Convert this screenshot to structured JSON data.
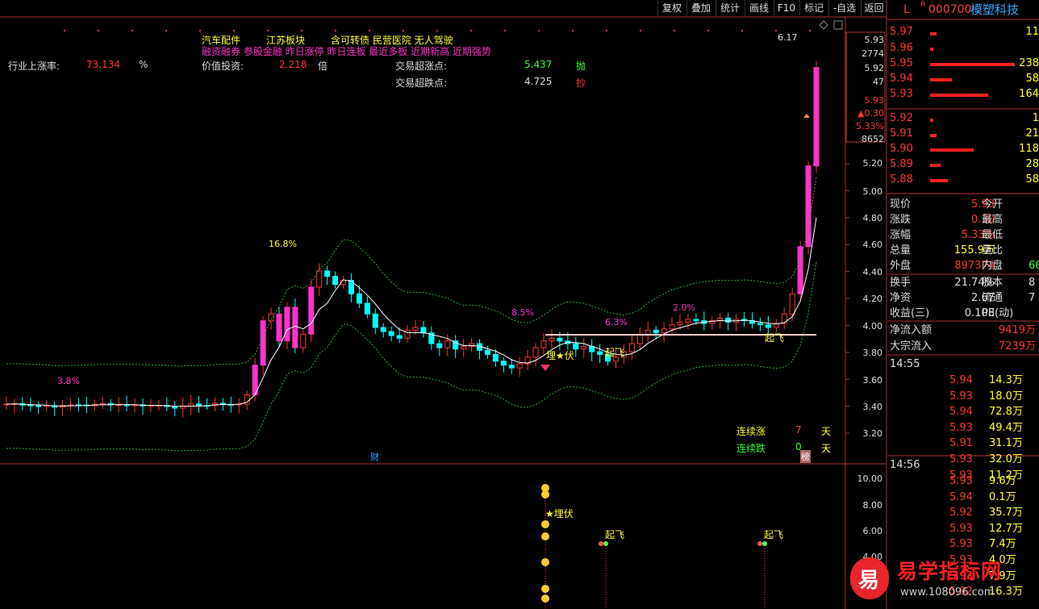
{
  "toolbar": {
    "buttons": [
      "复权",
      "叠加",
      "统计",
      "画线",
      "F10",
      "标记",
      "-自选",
      "返回"
    ]
  },
  "header": {
    "flag_l": "L",
    "flag_r": "R",
    "code": "000700",
    "name": "模塑科技"
  },
  "info": {
    "concepts_line1": [
      "汽车配件",
      "江苏板块",
      "含可转债 民营医院 无人驾驶"
    ],
    "concepts_line2": "融资融券 参股金融 昨日涨停 昨日连板 最近多板 近期新高 近期强势",
    "industry_label": "行业上涨率:",
    "industry_value": "73.134",
    "industry_unit": "%",
    "value_label": "价值投资:",
    "value_value": "2.218",
    "value_unit": "倍",
    "sell_label": "交易超涨点:",
    "sell_value": "5.437",
    "sell_tag": "抛",
    "buy_label": "交易超跌点:",
    "buy_value": "4.725",
    "buy_tag": "抄",
    "up_days_label": "连续涨",
    "up_days_value": "7",
    "up_days_unit": "天",
    "down_days_label": "连续跌",
    "down_days_value": "0",
    "down_days_unit": "天",
    "cai_tag": "财",
    "bang_tag": "榜"
  },
  "main_axis": {
    "ticks": [
      "5.93",
      "2774",
      "5.92",
      "47",
      "5.93",
      "▲0.30",
      "5.33%",
      "8652",
      "5.20",
      "5.00",
      "4.80",
      "4.60",
      "4.40",
      "4.20",
      "4.00",
      "3.80",
      "3.60",
      "3.40",
      "3.20"
    ]
  },
  "sub_axis": {
    "ticks": [
      "10.00",
      "8.00",
      "6.00",
      "4.00"
    ]
  },
  "chart_labels": {
    "peak_label": "6.17",
    "pct_labels": [
      "3.8%",
      "16.8%",
      "8.5%",
      "6.3%",
      "2.0%"
    ],
    "signal_maifu": "埋★伏",
    "signal_qifei": "起飞",
    "sub_maifu": "★埋伏",
    "sub_qifei": "起飞"
  },
  "order_book": {
    "asks": [
      {
        "price": "5.97",
        "vol": "11"
      },
      {
        "price": "5.96",
        "vol": ""
      },
      {
        "price": "5.95",
        "vol": "238"
      },
      {
        "price": "5.94",
        "vol": "58"
      },
      {
        "price": "5.93",
        "vol": "164"
      }
    ],
    "bids": [
      {
        "price": "5.92",
        "vol": "1"
      },
      {
        "price": "5.91",
        "vol": "21"
      },
      {
        "price": "5.90",
        "vol": "118"
      },
      {
        "price": "5.89",
        "vol": "28"
      },
      {
        "price": "5.88",
        "vol": "58"
      }
    ]
  },
  "quote": {
    "rows": [
      {
        "l1": "现价",
        "v1": "5.93",
        "l2": "今开",
        "v2": ""
      },
      {
        "l1": "涨跌",
        "v1": "0.30",
        "l2": "最高",
        "v2": ""
      },
      {
        "l1": "涨幅",
        "v1": "5.33%",
        "l2": "最低",
        "v2": ""
      },
      {
        "l1": "总量",
        "v1": "155.9万",
        "l2": "量比",
        "v2": ""
      },
      {
        "l1": "外盘",
        "v1": "897374",
        "l2": "内盘",
        "v2": "66"
      },
      {
        "l1": "换手",
        "v1": "21.74%",
        "l2": "股本",
        "v2": "8"
      },
      {
        "l1": "净资",
        "v1": "2.67",
        "l2": "流通",
        "v2": "7"
      },
      {
        "l1": "收益(三)",
        "v1": "0.108",
        "l2": "PE(动)",
        "v2": ""
      }
    ],
    "netflow_label": "净流入额",
    "netflow_value": "9419万",
    "bulk_label": "大宗流入",
    "bulk_value": "7239万"
  },
  "ticks_1455": {
    "time": "14:55",
    "rows": [
      {
        "p": "5.94",
        "v": "14.3万"
      },
      {
        "p": "5.93",
        "v": "18.0万"
      },
      {
        "p": "5.94",
        "v": "72.8万"
      },
      {
        "p": "5.93",
        "v": "49.4万"
      },
      {
        "p": "5.91",
        "v": "31.1万"
      },
      {
        "p": "5.93",
        "v": "32.0万"
      },
      {
        "p": "5.93",
        "v": "11.2万"
      }
    ]
  },
  "ticks_1456": {
    "time": "14:56",
    "rows": [
      {
        "p": "5.93",
        "v": "9.6万"
      },
      {
        "p": "5.94",
        "v": "0.1万"
      },
      {
        "p": "5.92",
        "v": "35.7万"
      },
      {
        "p": "5.93",
        "v": "12.7万"
      },
      {
        "p": "5.93",
        "v": "7.4万"
      },
      {
        "p": "5.93",
        "v": "4.0万"
      },
      {
        "p": "5.93",
        "v": "7.9万"
      },
      {
        "p": "5.92",
        "v": "16.3万"
      }
    ]
  },
  "watermark": {
    "logo_char": "易",
    "title": "易学指标网",
    "url": "www.108096.com"
  },
  "colors": {
    "up": "#ff3333",
    "down": "#00ffff",
    "magenta": "#ff33cc",
    "yellow": "#ffff33",
    "band": "#33aa33",
    "ma": "#ffffff"
  }
}
